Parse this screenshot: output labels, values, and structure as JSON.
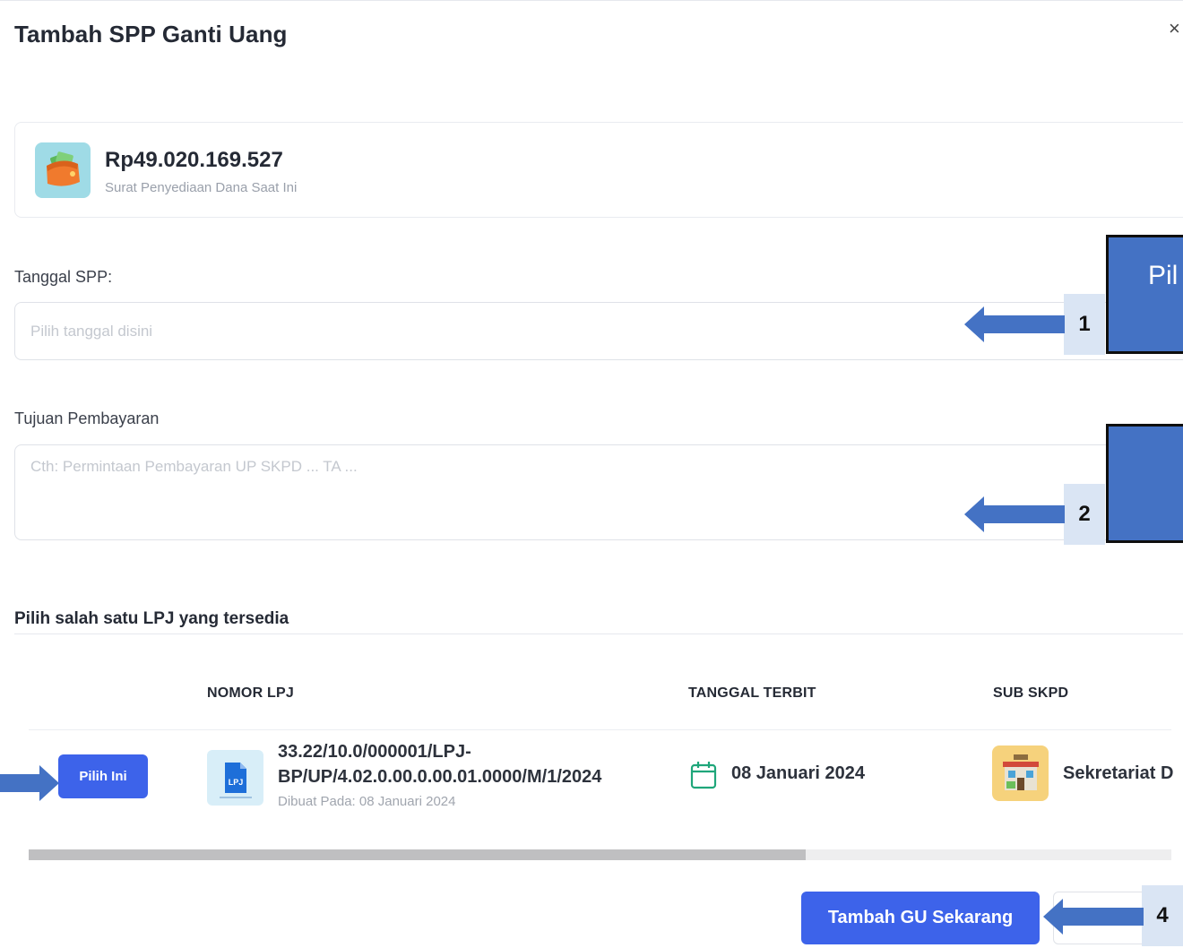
{
  "modal": {
    "title": "Tambah SPP Ganti Uang",
    "close_label": "×"
  },
  "balance": {
    "amount": "Rp49.020.169.527",
    "subtitle": "Surat Penyediaan Dana Saat Ini",
    "icon": "wallet-icon"
  },
  "form": {
    "tanggal_label": "Tanggal SPP:",
    "tanggal_placeholder": "Pilih tanggal disini",
    "tujuan_label": "Tujuan Pembayaran",
    "tujuan_placeholder": "Cth: Permintaan Pembayaran UP SKPD ... TA ..."
  },
  "lpj": {
    "section_title": "Pilih salah satu LPJ yang tersedia",
    "columns": [
      "NOMOR LPJ",
      "TANGGAL TERBIT",
      "SUB SKPD"
    ],
    "rows": [
      {
        "action_label": "Pilih Ini",
        "doc_badge": "LPJ",
        "number": "33.22/10.0/000001/LPJ-BP/UP/4.02.0.00.0.00.01.0000/M/1/2024",
        "created": "Dibuat Pada: 08 Januari 2024",
        "date": "08 Januari 2024",
        "sub_skpd": "Sekretariat D"
      }
    ],
    "scroll_position": 0.68
  },
  "actions": {
    "submit_label": "Tambah GU Sekarang"
  },
  "annotations": {
    "box_1_text": "Pil",
    "step_1": "1",
    "step_2": "2",
    "step_4": "4",
    "color": "#4472c4"
  },
  "colors": {
    "primary": "#3d63ea",
    "wallet_bg": "#9fdbe6",
    "skpd_bg": "#f6d27c",
    "calendar": "#1fa67a"
  }
}
